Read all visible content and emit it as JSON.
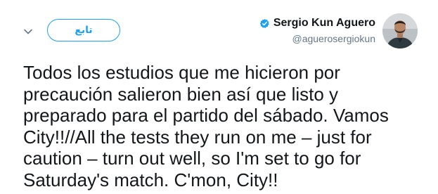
{
  "tweet": {
    "follow_label": "تابع",
    "author": {
      "display_name": "Sergio Kun Aguero",
      "handle": "@aguerosergiokun",
      "verified": true
    },
    "text": "Todos los estudios que me hicieron por\nprecaución salieron bien así que listo y\npreparado para el partido del sábado. Vamos\nCity!!//All the tests they run on me – just for\ncaution – turn out well, so I'm set to go for\nSaturday's match. C'mon, City!!"
  },
  "icons": {
    "menu": "chevron-down-icon",
    "verified": "verified-badge-icon"
  },
  "colors": {
    "accent": "#1da1f2",
    "text": "#14171a",
    "muted": "#657786"
  }
}
